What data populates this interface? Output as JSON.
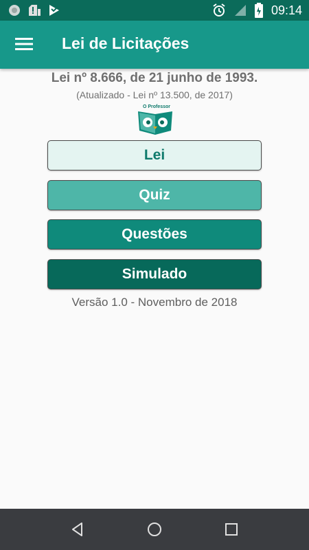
{
  "status_bar": {
    "time": "09:14",
    "left_icons": [
      "circle-notification-icon",
      "sim-alert-icon",
      "play-store-icon"
    ],
    "right_icons": [
      "alarm-icon",
      "signal-icon",
      "battery-icon"
    ]
  },
  "app_bar": {
    "title": "Lei de Licitações",
    "menu_icon": "hamburger-menu-icon"
  },
  "header": {
    "title": "Lei nº 8.666, de 21 junho de 1993.",
    "subtitle": "(Atualizado - Lei nº 13.500, de 2017)",
    "logo_text": "O Professor"
  },
  "buttons": {
    "lei": "Lei",
    "quiz": "Quiz",
    "questoes": "Questões",
    "simulado": "Simulado"
  },
  "version": "Versão 1.0 - Novembro de 2018",
  "nav_bar": {
    "back_icon": "back-triangle-icon",
    "home_icon": "home-circle-icon",
    "recents_icon": "recents-square-icon"
  },
  "colors": {
    "status_bar": "#0b6b5a",
    "app_bar": "#17988a",
    "btn_lei": "#e4f4f1",
    "btn_quiz": "#4eb6a8",
    "btn_questoes": "#0f8a7b",
    "btn_simulado": "#07695a"
  }
}
